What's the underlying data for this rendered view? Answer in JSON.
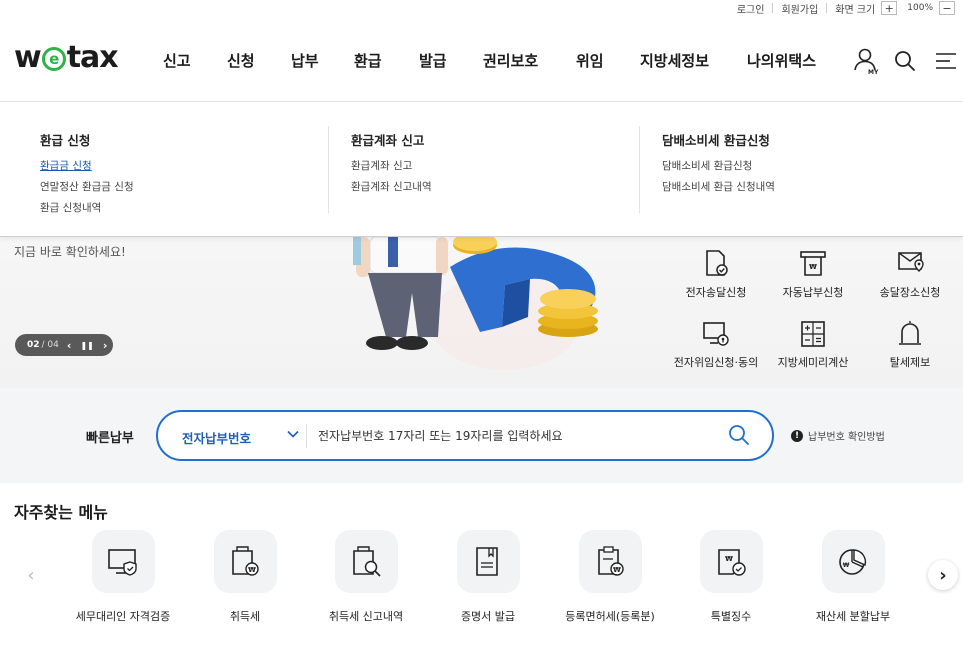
{
  "utility": {
    "login": "로그인",
    "signup": "회원가입",
    "zoom_label": "화면 크기",
    "zoom_in": "+",
    "zoom_value": "100%",
    "zoom_out": "−"
  },
  "header": {
    "logo": {
      "before": "w",
      "mark": "e",
      "after": "tax"
    },
    "nav": [
      "신고",
      "신청",
      "납부",
      "환급",
      "발급",
      "권리보호",
      "위임",
      "지방세정보",
      "나의위택스"
    ],
    "icons": [
      "my-user-icon",
      "search-icon",
      "menu-icon"
    ],
    "my_badge": "MY"
  },
  "mega_menu": {
    "columns": [
      {
        "title": "환급 신청",
        "items": [
          "환급금 신청",
          "연말정산 환급금 신청",
          "환급 신청내역"
        ],
        "active": 0
      },
      {
        "title": "환급계좌 신고",
        "items": [
          "환급계좌 신고",
          "환급계좌 신고내역"
        ]
      },
      {
        "title": "담배소비세 환급신청",
        "items": [
          "담배소비세 환급신청",
          "담배소비세 환급 신청내역"
        ]
      }
    ]
  },
  "hero": {
    "subtitle": "지금 바로 확인하세요!",
    "pager": {
      "current": "02",
      "total": "/ 04",
      "prev": "‹",
      "pause": "❚❚",
      "next": "›"
    },
    "services": [
      {
        "label": "전자송달신청",
        "icon": "e-delivery-icon"
      },
      {
        "label": "자동납부신청",
        "icon": "auto-payment-icon"
      },
      {
        "label": "송달장소신청",
        "icon": "delivery-location-icon"
      },
      {
        "label": "전자위임신청·동의",
        "icon": "e-delegation-icon"
      },
      {
        "label": "지방세미리계산",
        "icon": "calculator-icon"
      },
      {
        "label": "탈세제보",
        "icon": "report-bell-icon"
      }
    ]
  },
  "quick_pay": {
    "label": "빠른납부",
    "select_value": "전자납부번호",
    "placeholder": "전자납부번호 17자리 또는 19자리를 입력하세요",
    "help": "납부번호 확인방법",
    "help_mark": "!"
  },
  "frequent": {
    "title": "자주찾는 메뉴",
    "items": [
      {
        "label": "세무대리인 자격검증",
        "icon": "monitor-shield-icon"
      },
      {
        "label": "취득세",
        "icon": "acquisition-tax-icon"
      },
      {
        "label": "취득세 신고내역",
        "icon": "acquisition-history-icon"
      },
      {
        "label": "증명서 발급",
        "icon": "certificate-icon"
      },
      {
        "label": "등록면허세(등록분)",
        "icon": "registration-tax-icon"
      },
      {
        "label": "특별징수",
        "icon": "special-collection-icon"
      },
      {
        "label": "재산세 분할납부",
        "icon": "property-tax-installment-icon"
      }
    ],
    "prev": "‹",
    "next": "›"
  },
  "colors": {
    "accent": "#1f6fcf",
    "logo_green": "#2db34a",
    "active_link": "#1559b7",
    "pager_bg": "#595959"
  }
}
